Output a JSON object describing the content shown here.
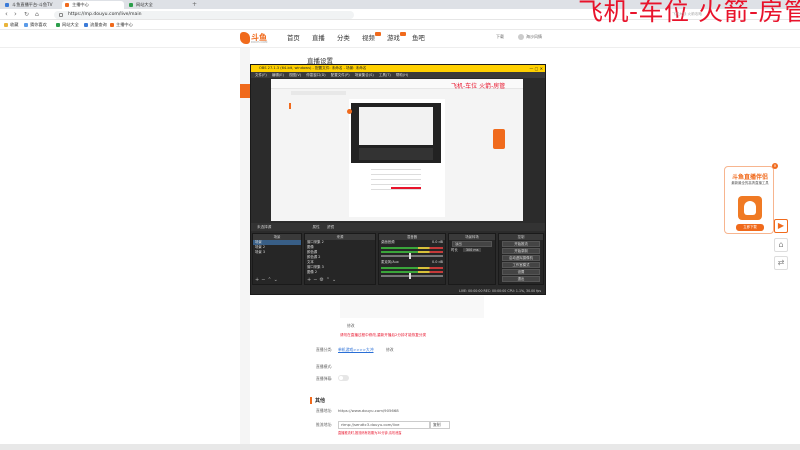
{
  "browser": {
    "tabs": [
      {
        "label": "斗鱼直播平台-斗鱼TV",
        "color": "#3b7bd8"
      },
      {
        "label": "主播中心",
        "color": "#f06a1c",
        "active": true
      },
      {
        "label": "网站大全",
        "color": "#2c9e4b"
      }
    ],
    "url": "https://mp.douyu.com/live/main",
    "bookmarks": [
      "收藏",
      "猜你喜欢",
      "网站大全",
      "流量查询",
      "主播中心"
    ]
  },
  "overlay": {
    "headline": "飞机-车位  火箭-房管",
    "small": "飞机大战 火箭攻略"
  },
  "site": {
    "logo_text": "斗鱼",
    "logo_sub": "DOUYU.COM",
    "nav": [
      "首页",
      "直播",
      "分类",
      "视频",
      "游戏",
      "鱼吧"
    ],
    "right": [
      "下载",
      "海沙风情"
    ]
  },
  "page": {
    "title": "直播设置",
    "side_header": "主播中心"
  },
  "obs": {
    "title": "OBS 27.1.3 (64-bit, windows) - 配置文件: 未命名 - 场景: 未命名",
    "menu": [
      "文件(F)",
      "编辑(E)",
      "视图(V)",
      "停靠窗口(D)",
      "配置文件(P)",
      "场景集合(S)",
      "工具(T)",
      "帮助(H)"
    ],
    "preview_overlay": "飞机-车位  火箭-房管",
    "docks_bar": "未选择源",
    "docks_bar_tabs": [
      "属性",
      "滤镜"
    ],
    "scenes": {
      "header": "场景",
      "items": [
        "场景",
        "场景 2",
        "场景 3"
      ]
    },
    "sources": {
      "header": "来源",
      "items": [
        "窗口采集 2",
        "图像",
        "颜色源",
        "颜色源 2",
        "文本",
        "窗口采集 3",
        "图像 2"
      ]
    },
    "mixer": {
      "header": "混音器",
      "channels": [
        {
          "name": "桌面音频",
          "level": "0.0 dB"
        },
        {
          "name": "麦克风/Aux",
          "level": "0.0 dB"
        }
      ]
    },
    "transitions": {
      "header": "场景转场",
      "type": "淡出",
      "duration_label": "时长",
      "duration": "300 ms"
    },
    "controls": {
      "header": "控制",
      "buttons": [
        "开始推流",
        "开始录制",
        "启动虚拟摄像机",
        "工作室模式",
        "设置",
        "退出"
      ]
    },
    "status": "LIVE: 00:00:00  REC: 00:00:00  CPU: 1.1%, 30.00 fps"
  },
  "form": {
    "modify_label": "修改",
    "warning": "请勿在直播过程中修改,重新开播后2分钟才能恢复分类",
    "row1_label": "直播分类:",
    "row1_value": "单机游戏>>>>大冲",
    "row1_btn": "修改",
    "row2_label": "直播模式:",
    "row3_label": "直播弹幕:",
    "section_title": "其他",
    "addr_label": "直播地址:",
    "addr_value": "https://www.douyu.com/905668",
    "rtmp_label": "推流地址:",
    "rtmp_value": "rtmp://sendtc3.douyu.com/live",
    "rtmp_select": "复制",
    "tip": "直播推流时,推流码有效期为30分钟,请勿泄露"
  },
  "promo": {
    "title": "斗鱼直播伴侣",
    "sub": "最新最全的高清直播工具",
    "btn": "立即下载",
    "close": "×"
  }
}
